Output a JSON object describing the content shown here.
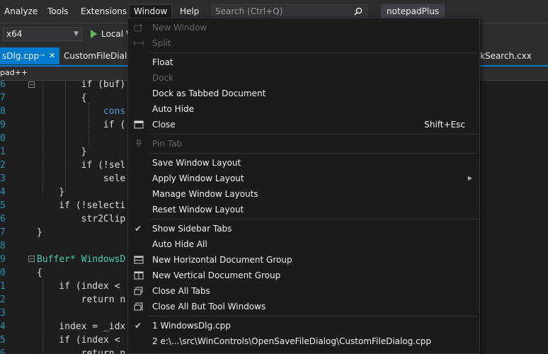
{
  "menubar": {
    "items": [
      {
        "label": "Analyze"
      },
      {
        "label": "Tools"
      },
      {
        "label": "Extensions"
      },
      {
        "label": "Window"
      },
      {
        "label": "Help"
      }
    ],
    "search_placeholder": "Search (Ctrl+Q)",
    "search_icon": "search-icon",
    "solution_title": "notepadPlus"
  },
  "toolbar": {
    "platform_value": "x64",
    "run_label": "Local W"
  },
  "tabs": {
    "active": "sDlg.cpp",
    "second": "CustomFileDialo",
    "right": "kSearch.cxx"
  },
  "navbar": {
    "project": "pad++"
  },
  "editor": {
    "lines": [
      {
        "n": "6",
        "code": "        if (buf)"
      },
      {
        "n": "7",
        "code": "        {"
      },
      {
        "n": "8",
        "code": "            cons"
      },
      {
        "n": "9",
        "code": "            if ("
      },
      {
        "n": "0",
        "code": ""
      },
      {
        "n": "1",
        "code": "        }"
      },
      {
        "n": "2",
        "code": "        if (!sel"
      },
      {
        "n": "3",
        "code": "            sele"
      },
      {
        "n": "4",
        "code": "    }"
      },
      {
        "n": "5",
        "code": "    if (!selecti"
      },
      {
        "n": "6",
        "code": "        str2Clip"
      },
      {
        "n": "7",
        "code": "}"
      },
      {
        "n": "8",
        "code": ""
      },
      {
        "n": "9",
        "code": "Buffer* WindowsD"
      },
      {
        "n": "0",
        "code": "{"
      },
      {
        "n": "1",
        "code": "    if (index <"
      },
      {
        "n": "2",
        "code": "        return n"
      },
      {
        "n": "3",
        "code": ""
      },
      {
        "n": "4",
        "code": "    index = _idx"
      },
      {
        "n": "5",
        "code": "    if (index <"
      },
      {
        "n": "6",
        "code": "        return n"
      }
    ]
  },
  "window_menu": {
    "items": [
      {
        "label": "New Window",
        "disabled": true,
        "icon": "new-window-icon"
      },
      {
        "label": "Split",
        "disabled": true,
        "icon": "split-icon"
      },
      {
        "label": "Float"
      },
      {
        "label": "Dock",
        "disabled": true
      },
      {
        "label": "Dock as Tabbed Document"
      },
      {
        "label": "Auto Hide"
      },
      {
        "label": "Close",
        "shortcut": "Shift+Esc",
        "icon": "close-window-icon"
      },
      {
        "label": "Pin Tab",
        "disabled": true,
        "icon": "pin-icon"
      },
      {
        "label": "Save Window Layout"
      },
      {
        "label": "Apply Window Layout",
        "submenu": true
      },
      {
        "label": "Manage Window Layouts"
      },
      {
        "label": "Reset Window Layout"
      },
      {
        "label": "Show Sidebar Tabs",
        "checked": true
      },
      {
        "label": "Auto Hide All"
      },
      {
        "label": "New Horizontal Document Group",
        "icon": "horizontal-group-icon"
      },
      {
        "label": "New Vertical Document Group",
        "icon": "vertical-group-icon"
      },
      {
        "label": "Close All Tabs",
        "icon": "close-all-tabs-icon"
      },
      {
        "label": "Close All But Tool Windows",
        "icon": "close-all-but-tool-icon"
      },
      {
        "label": "1 WindowsDlg.cpp",
        "checked": true
      },
      {
        "label": "2 e:\\...\\src\\WinControls\\OpenSaveFileDialog\\CustomFileDialog.cpp"
      }
    ]
  },
  "colors": {
    "accent": "#007acc",
    "menu_bg": "#1b1b1c",
    "chrome_bg": "#2d2d30",
    "editor_bg": "#1e1e1e",
    "line_number": "#2b91af",
    "keyword": "#569cd6",
    "type": "#4ec9b0"
  }
}
